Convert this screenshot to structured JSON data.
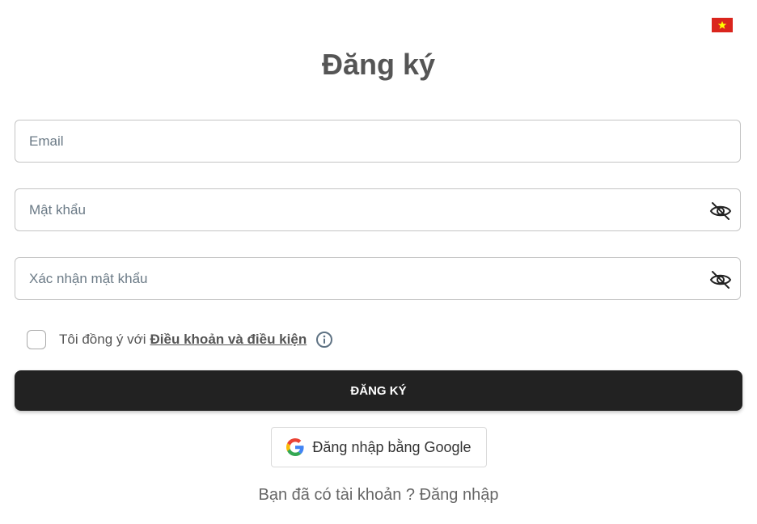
{
  "language": {
    "flag": "vietnam-flag",
    "colors": {
      "red": "#da251d",
      "star": "#ffff00"
    }
  },
  "title": "Đăng ký",
  "form": {
    "email_placeholder": "Email",
    "password_placeholder": "Mật khẩu",
    "confirm_password_placeholder": "Xác nhận mật khẩu",
    "agree_text": "Tôi đồng ý với",
    "terms_link": "Điều khoản và điều kiện",
    "submit_label": "ĐĂNG KÝ"
  },
  "google": {
    "label": "Đăng nhập bằng Google",
    "icon": "google-icon"
  },
  "footer": {
    "prompt": "Bạn đã có tài khoản ?",
    "login_link": "Đăng nhập"
  },
  "theme": {
    "button_bg": "#222222",
    "title_color": "#555555",
    "border_color": "#c4c4c4"
  }
}
